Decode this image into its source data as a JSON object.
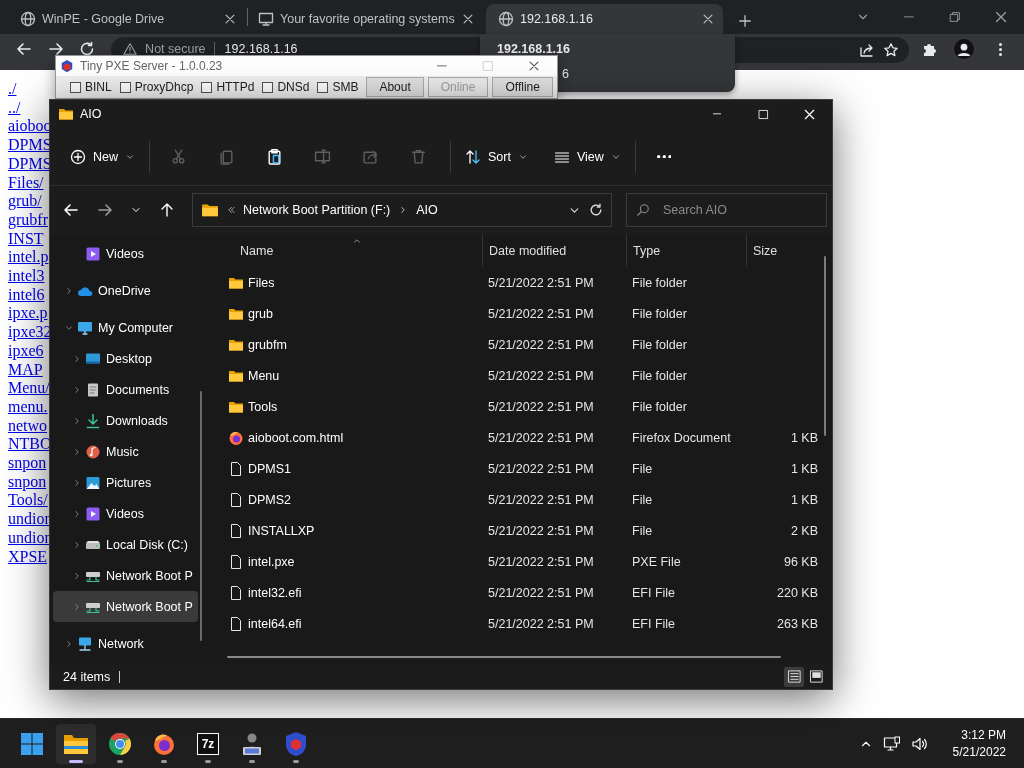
{
  "browser": {
    "tabs": [
      {
        "kind": "globe",
        "title": "WinPE - Google Drive",
        "selected": false
      },
      {
        "kind": "monitor",
        "title": "Your favorite operating systems",
        "selected": false
      },
      {
        "kind": "globe",
        "title": "192.168.1.16",
        "selected": true
      }
    ],
    "security": "Not secure",
    "address": "192.168.1.16",
    "tooltip": {
      "line_1": "192.168.1.16",
      "line_2": "6"
    }
  },
  "page": {
    "links": [
      "./",
      "../",
      "aioboo",
      "DPMS",
      "DPMS",
      "Files/",
      "grub/",
      "grubfr",
      "INST",
      "intel.p",
      "intel3",
      "intel6",
      "ipxe.p",
      "ipxe32",
      "ipxe6",
      "MAP",
      "Menu/",
      "menu.",
      "netwo",
      "NTBO",
      "snpon",
      "snpon",
      "Tools/",
      "undion",
      "undion",
      "XPSE"
    ]
  },
  "pxe_window": {
    "title": "Tiny PXE Server - 1.0.0.23",
    "options": [
      {
        "label": "BINL",
        "checked": false
      },
      {
        "label": "ProxyDhcp",
        "checked": false
      },
      {
        "label": "HTTPd",
        "checked": false
      },
      {
        "label": "DNSd",
        "checked": false
      },
      {
        "label": "SMB",
        "checked": false
      }
    ],
    "buttons": [
      {
        "label": "About",
        "disabled": false
      },
      {
        "label": "Online",
        "disabled": true
      },
      {
        "label": "Offline",
        "disabled": false
      }
    ]
  },
  "explorer": {
    "title": "AIO",
    "toolbar": [
      {
        "kind": "new",
        "label": "New",
        "disabled": false
      },
      {
        "kind": "cut",
        "disabled": true
      },
      {
        "kind": "copy",
        "disabled": true
      },
      {
        "kind": "paste",
        "disabled": false
      },
      {
        "kind": "rename",
        "disabled": true
      },
      {
        "kind": "share",
        "disabled": true
      },
      {
        "kind": "delete",
        "disabled": true
      },
      {
        "kind": "sort",
        "label": "Sort",
        "disabled": false
      },
      {
        "kind": "view",
        "label": "View",
        "disabled": false
      },
      {
        "kind": "more",
        "disabled": false
      }
    ],
    "path": [
      "Network Boot Partition (F:)",
      "AIO"
    ],
    "search_placeholder": "Search AIO",
    "nav": [
      {
        "kind": "videos",
        "label": "Videos",
        "selected": false
      },
      {
        "kind": "onedrive",
        "label": "OneDrive",
        "expanded": false,
        "selected": false
      },
      {
        "kind": "computer",
        "label": "My Computer",
        "expanded": true,
        "selected": false,
        "children": [
          {
            "kind": "desktop",
            "label": "Desktop",
            "expanded": false,
            "selected": false
          },
          {
            "kind": "documents",
            "label": "Documents",
            "expanded": false,
            "selected": false
          },
          {
            "kind": "downloads",
            "label": "Downloads",
            "expanded": false,
            "selected": false
          },
          {
            "kind": "music",
            "label": "Music",
            "expanded": false,
            "selected": false
          },
          {
            "kind": "pictures",
            "label": "Pictures",
            "expanded": false,
            "selected": false
          },
          {
            "kind": "videos",
            "label": "Videos",
            "expanded": false,
            "selected": false
          },
          {
            "kind": "drive",
            "label": "Local Disk (C:)",
            "expanded": false,
            "selected": false
          },
          {
            "kind": "netdrive",
            "label": "Network Boot P",
            "expanded": false,
            "selected": false
          },
          {
            "kind": "netdrive",
            "label": "Network Boot P",
            "expanded": false,
            "selected": true
          }
        ]
      },
      {
        "kind": "network",
        "label": "Network",
        "expanded": false,
        "selected": false
      }
    ],
    "columns": [
      {
        "label": "Name",
        "sorted": true
      },
      {
        "label": "Date modified",
        "sorted": false
      },
      {
        "label": "Type",
        "sorted": false
      },
      {
        "label": "Size",
        "sorted": false
      }
    ],
    "files": [
      {
        "kind": "folder",
        "name": "Files",
        "date": "5/21/2022 2:51 PM",
        "type": "File folder"
      },
      {
        "kind": "folder",
        "name": "grub",
        "date": "5/21/2022 2:51 PM",
        "type": "File folder"
      },
      {
        "kind": "folder",
        "name": "grubfm",
        "date": "5/21/2022 2:51 PM",
        "type": "File folder"
      },
      {
        "kind": "folder",
        "name": "Menu",
        "date": "5/21/2022 2:51 PM",
        "type": "File folder"
      },
      {
        "kind": "folder",
        "name": "Tools",
        "date": "5/21/2022 2:51 PM",
        "type": "File folder"
      },
      {
        "kind": "firefox",
        "name": "aioboot.com.html",
        "date": "5/21/2022 2:51 PM",
        "type": "Firefox Document",
        "size": "1 KB"
      },
      {
        "kind": "file",
        "name": "DPMS1",
        "date": "5/21/2022 2:51 PM",
        "type": "File",
        "size": "1 KB"
      },
      {
        "kind": "file",
        "name": "DPMS2",
        "date": "5/21/2022 2:51 PM",
        "type": "File",
        "size": "1 KB"
      },
      {
        "kind": "file",
        "name": "INSTALLXP",
        "date": "5/21/2022 2:51 PM",
        "type": "File",
        "size": "2 KB"
      },
      {
        "kind": "file",
        "name": "intel.pxe",
        "date": "5/21/2022 2:51 PM",
        "type": "PXE File",
        "size": "96 KB"
      },
      {
        "kind": "file",
        "name": "intel32.efi",
        "date": "5/21/2022 2:51 PM",
        "type": "EFI File",
        "size": "220 KB"
      },
      {
        "kind": "file",
        "name": "intel64.efi",
        "date": "5/21/2022 2:51 PM",
        "type": "EFI File",
        "size": "263 KB"
      }
    ],
    "status": "24 items",
    "views": [
      {
        "kind": "details",
        "selected": true
      },
      {
        "kind": "tiles",
        "selected": false
      }
    ]
  },
  "taskbar": {
    "apps": [
      {
        "kind": "start",
        "active": false
      },
      {
        "kind": "explorer",
        "active": true
      },
      {
        "kind": "chrome",
        "active": false
      },
      {
        "kind": "firefox",
        "active": false
      },
      {
        "kind": "sevenzip",
        "label": "7z",
        "active": false
      },
      {
        "kind": "pxe",
        "active": false
      },
      {
        "kind": "cube",
        "active": false
      }
    ],
    "time": "3:12 PM",
    "date": "5/21/2022"
  }
}
